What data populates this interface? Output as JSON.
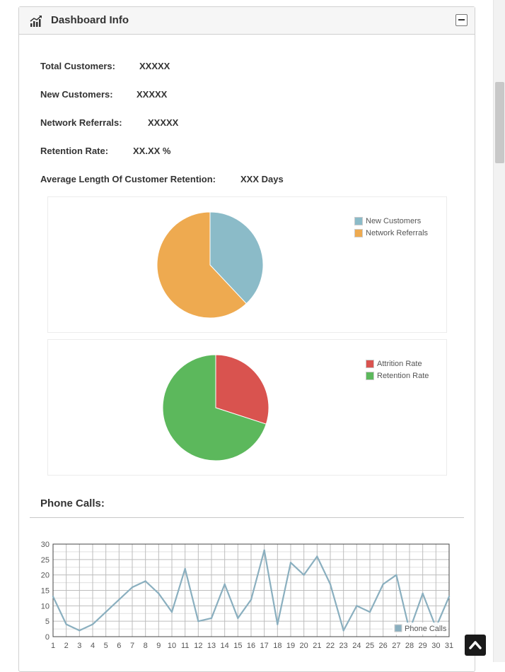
{
  "header": {
    "title": "Dashboard Info",
    "icon": "bar-chart-icon",
    "collapse_icon": "minus-icon"
  },
  "stats": [
    {
      "label": "Total Customers:",
      "value": "XXXXX"
    },
    {
      "label": "New Customers:",
      "value": "XXXXX"
    },
    {
      "label": "Network Referrals:",
      "value": "XXXXX"
    },
    {
      "label": "Retention Rate:",
      "value": "XX.XX %"
    },
    {
      "label": "Average Length Of Customer Retention:",
      "value": "XXX Days"
    }
  ],
  "phone_calls": {
    "title": "Phone Calls:"
  },
  "colors": {
    "new_customers": "#8bbbc8",
    "network_referrals": "#eeaa50",
    "attrition": "#d9534f",
    "retention": "#5cb85c",
    "line": "#8aafbf"
  },
  "back_to_top_icon": "chevron-up-icon",
  "chart_data": [
    {
      "type": "pie",
      "labels": [
        "New Customers",
        "Network Referrals"
      ],
      "values": [
        38,
        62
      ],
      "legend_position": "top-right"
    },
    {
      "type": "pie",
      "labels": [
        "Attrition Rate",
        "Retention Rate"
      ],
      "values": [
        30,
        70
      ],
      "legend_position": "top-right"
    },
    {
      "type": "line",
      "x": [
        1,
        2,
        3,
        4,
        5,
        6,
        7,
        8,
        9,
        10,
        11,
        12,
        13,
        14,
        15,
        16,
        17,
        18,
        19,
        20,
        21,
        22,
        23,
        24,
        25,
        26,
        27,
        28,
        29,
        30,
        31
      ],
      "series": [
        {
          "name": "Phone Calls",
          "values": [
            13,
            4,
            2,
            4,
            8,
            12,
            16,
            18,
            14,
            8,
            22,
            5,
            6,
            17,
            6,
            12,
            28,
            4,
            24,
            20,
            26,
            17,
            2,
            10,
            8,
            17,
            20,
            2,
            14,
            3,
            13
          ]
        }
      ],
      "ylim": [
        0,
        30
      ],
      "yticks": [
        0,
        5,
        10,
        15,
        20,
        25,
        30
      ],
      "grid": true,
      "legend_position": "bottom-right"
    }
  ]
}
